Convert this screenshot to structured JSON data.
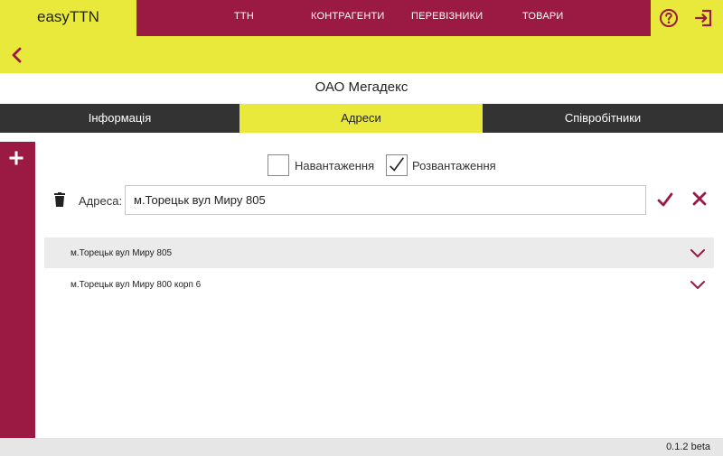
{
  "app": {
    "title": "easyTTN"
  },
  "nav": {
    "items": [
      "ТТН",
      "КОНТРАГЕНТИ",
      "ПЕРЕВІЗНИКИ",
      "ТОВАРИ"
    ]
  },
  "header_icons": [
    "help-circle-icon",
    "logout-icon"
  ],
  "back_icon": "chevron-left-icon",
  "company": {
    "name": "ОАО Мегадекс"
  },
  "tabs": [
    {
      "label": "Інформація",
      "active": false
    },
    {
      "label": "Адреси",
      "active": true
    },
    {
      "label": "Співробітники",
      "active": false
    }
  ],
  "sidebar": {
    "add_icon": "plus-icon"
  },
  "address_form": {
    "loading": {
      "label": "Навантаження",
      "checked": false
    },
    "unloading": {
      "label": "Розвантаження",
      "checked": true
    },
    "label": "Адреса:",
    "value": "м.Торецьк вул Миру 805",
    "icons": {
      "delete": "trash-icon",
      "confirm": "check-icon",
      "cancel": "close-icon"
    }
  },
  "addresses": [
    {
      "text": "м.Торецьк вул Миру 805"
    },
    {
      "text": "м.Торецьк вул Миру 800 корп 6"
    }
  ],
  "footer": {
    "version": "0.1.2 beta"
  },
  "colors": {
    "accent_yellow": "#e9e93b",
    "brand_maroon": "#9a1a43",
    "tab_dark": "#333333"
  }
}
